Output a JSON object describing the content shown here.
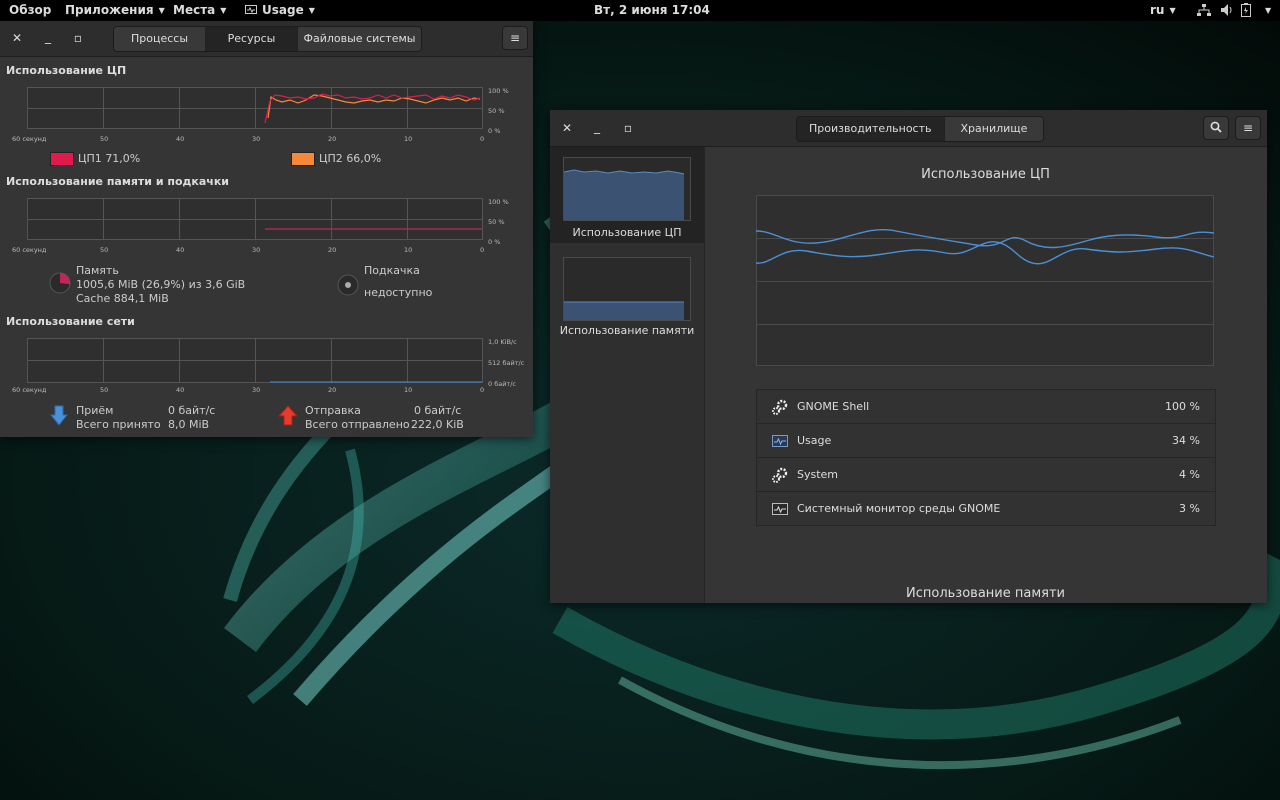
{
  "topbar": {
    "activities": "Обзор",
    "applications": "Приложения",
    "places": "Места",
    "app_name": "Usage",
    "clock": "Вт, 2 июня  17:04",
    "lang": "ru"
  },
  "system_monitor": {
    "tabs": [
      "Процессы",
      "Ресурсы",
      "Файловые системы"
    ],
    "active_tab": "Ресурсы",
    "x_ticks": [
      "60 секунд",
      "50",
      "40",
      "30",
      "20",
      "10",
      "0"
    ],
    "cpu": {
      "title": "Использование ЦП",
      "y_ticks": [
        "100 %",
        "50 %",
        "0 %"
      ],
      "cpu1_label": "ЦП1",
      "cpu1_value": "71,0%",
      "cpu1_color": "#e01b4c",
      "cpu2_label": "ЦП2",
      "cpu2_value": "66,0%",
      "cpu2_color": "#f6883a"
    },
    "memory": {
      "title": "Использование памяти и подкачки",
      "y_ticks": [
        "100 %",
        "50 %",
        "0 %"
      ],
      "mem_label": "Память",
      "mem_value": "1005,6 MiB (26,9%) из 3,6 GiB",
      "cache_value": "Cache 884,1 MiB",
      "swap_label": "Подкачка",
      "swap_value": "недоступно",
      "mem_color": "#c0265b",
      "mem_fraction": 0.269
    },
    "network": {
      "title": "Использование сети",
      "y_ticks": [
        "1,0 KiB/с",
        "512 байт/с",
        "0 байт/с"
      ],
      "rx_label": "Приём",
      "rx_rate": "0 байт/с",
      "rx_total_label": "Всего принято",
      "rx_total": "8,0 MiB",
      "tx_label": "Отправка",
      "tx_rate": "0 байт/с",
      "tx_total_label": "Всего отправлено",
      "tx_total": "222,0 KiB"
    }
  },
  "usage": {
    "tabs": [
      "Производительность",
      "Хранилище"
    ],
    "active_tab": "Производительность",
    "sidebar": [
      {
        "label": "Использование ЦП",
        "selected": true
      },
      {
        "label": "Использование памяти",
        "selected": false
      }
    ],
    "cpu_title": "Использование ЦП",
    "memory_title": "Использование памяти",
    "processes": [
      {
        "name": "GNOME Shell",
        "value": "100 %",
        "icon": "gears-icon"
      },
      {
        "name": "Usage",
        "value": "34 %",
        "icon": "monitor-icon"
      },
      {
        "name": "System",
        "value": "4 %",
        "icon": "gears-icon"
      },
      {
        "name": "Системный монитор среды GNOME",
        "value": "3 %",
        "icon": "monitor-icon"
      }
    ]
  }
}
